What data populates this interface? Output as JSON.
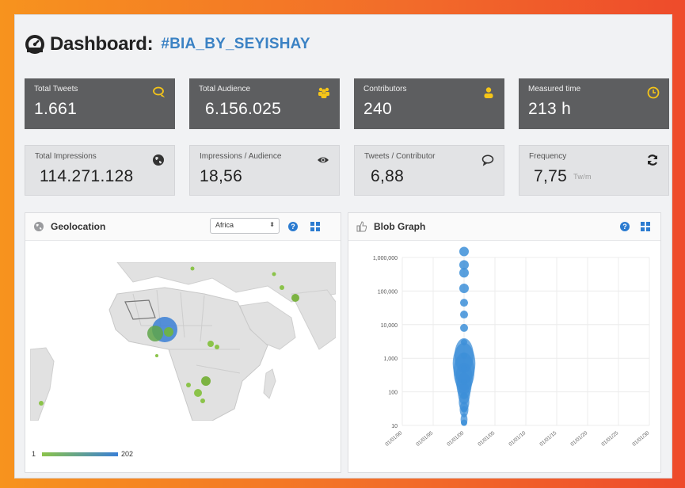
{
  "header": {
    "title": "Dashboard:",
    "hashtag": "#BIA_BY_SEYISHAY"
  },
  "stats_row1": [
    {
      "label": "Total Tweets",
      "value": "1.661",
      "icon": "chat-bubbles-icon"
    },
    {
      "label": "Total Audience",
      "value": "6.156.025",
      "icon": "users-group-icon"
    },
    {
      "label": "Contributors",
      "value": "240",
      "icon": "user-icon"
    },
    {
      "label": "Measured time",
      "value": "213 h",
      "icon": "clock-icon"
    }
  ],
  "stats_row2": [
    {
      "label": "Total Impressions",
      "value": "114.271.128",
      "icon": "globe-icon"
    },
    {
      "label": "Impressions / Audience",
      "value": "18,56",
      "icon": "eye-icon"
    },
    {
      "label": "Tweets / Contributor",
      "value": "6,88",
      "icon": "speech-bubble-icon"
    },
    {
      "label": "Frequency",
      "value": "7,75",
      "unit": "Tw/m",
      "icon": "refresh-icon"
    }
  ],
  "geolocation": {
    "title": "Geolocation",
    "region_select": "Africa",
    "legend_min": "1",
    "legend_max": "202"
  },
  "blob_graph": {
    "title": "Blob Graph"
  },
  "colors": {
    "accent": "#3b82c4",
    "dark_tile": "#5d5e60",
    "icon_yellow": "#f5c518",
    "blob_blue": "#3d8fd8"
  },
  "chart_data": {
    "type": "scatter",
    "title": "Blob Graph",
    "y_scale": "log",
    "ylim": [
      10,
      1000000
    ],
    "y_ticks": [
      "1,000,000",
      "100,000",
      "10,000",
      "1,000",
      "100",
      "10"
    ],
    "x_ticks": [
      "01/01/90",
      "01/01/95",
      "01/01/00",
      "01/01/05",
      "01/01/10",
      "01/01/15",
      "01/01/20",
      "01/01/25",
      "01/01/30"
    ],
    "series": [
      {
        "values": [
          {
            "x": "01/01/00",
            "y": 1500000
          },
          {
            "x": "01/01/00",
            "y": 600000
          },
          {
            "x": "01/01/00",
            "y": 350000
          },
          {
            "x": "01/01/00",
            "y": 120000
          },
          {
            "x": "01/01/00",
            "y": 45000
          },
          {
            "x": "01/01/00",
            "y": 20000
          },
          {
            "x": "01/01/00",
            "y": 8000
          },
          {
            "x": "01/01/00",
            "y": 3000
          },
          {
            "x": "01/01/00",
            "y": 1200
          },
          {
            "x": "01/01/00",
            "y": 500
          },
          {
            "x": "01/01/00",
            "y": 200
          },
          {
            "x": "01/01/00",
            "y": 80
          },
          {
            "x": "01/01/00",
            "y": 30
          },
          {
            "x": "01/01/00",
            "y": 12
          }
        ]
      }
    ]
  }
}
